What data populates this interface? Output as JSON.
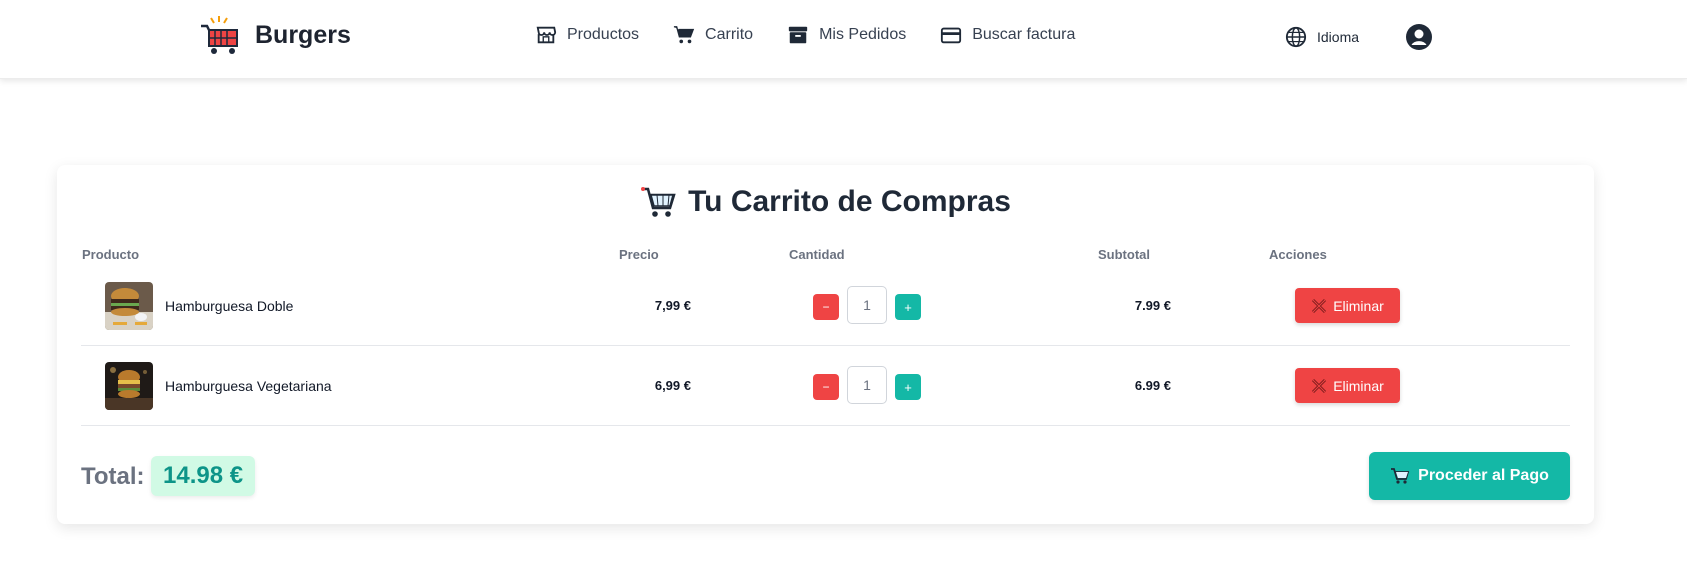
{
  "header": {
    "brand": "Burgers",
    "nav": [
      {
        "label": "Productos",
        "icon": "store-icon"
      },
      {
        "label": "Carrito",
        "icon": "cart-icon"
      },
      {
        "label": "Mis Pedidos",
        "icon": "archive-icon"
      },
      {
        "label": "Buscar factura",
        "icon": "credit-card-icon"
      }
    ],
    "language_label": "Idioma"
  },
  "cart": {
    "title": "Tu Carrito de Compras",
    "columns": {
      "product": "Producto",
      "price": "Precio",
      "quantity": "Cantidad",
      "subtotal": "Subtotal",
      "actions": "Acciones"
    },
    "items": [
      {
        "name": "Hamburguesa Doble",
        "price": "7,99 €",
        "quantity": "1",
        "subtotal": "7.99 €",
        "minus": "−",
        "plus": "+",
        "delete_label": "Eliminar"
      },
      {
        "name": "Hamburguesa Vegetariana",
        "price": "6,99 €",
        "quantity": "1",
        "subtotal": "6.99 €",
        "minus": "−",
        "plus": "+",
        "delete_label": "Eliminar"
      }
    ],
    "total_label": "Total:",
    "total_value": "14.98 €",
    "checkout_label": "Proceder al Pago"
  },
  "colors": {
    "accent": "#14b8a6",
    "danger": "#ef4444",
    "total_badge_bg": "#d1fae5",
    "total_text": "#0d9488"
  }
}
